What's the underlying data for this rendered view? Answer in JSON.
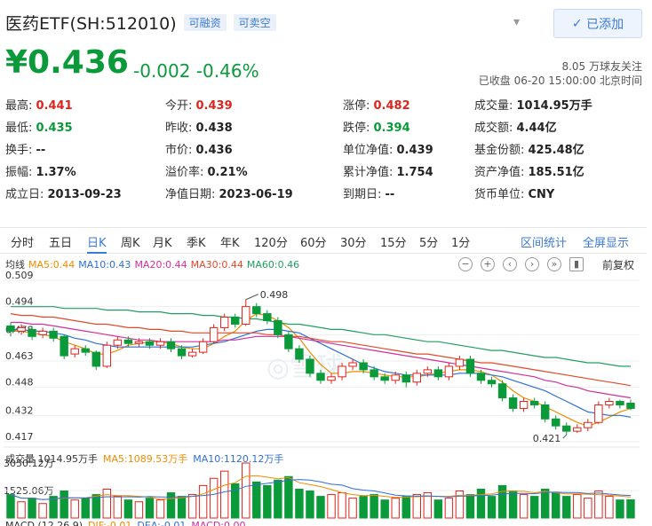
{
  "header": {
    "name": "医药ETF(SH:512010)",
    "tags": [
      "可融资",
      "可卖空"
    ],
    "add_button": "已添加",
    "price": "¥0.436",
    "change": "-0.002",
    "change_pct": "-0.46%",
    "followers": "8.05 万球友关注",
    "status": "已收盘 06-20 15:00:00 北京时间"
  },
  "quote": [
    [
      {
        "label": "最高:",
        "value": "0.441",
        "tone": "up"
      },
      {
        "label": "今开:",
        "value": "0.439",
        "tone": "up"
      },
      {
        "label": "涨停:",
        "value": "0.482",
        "tone": "up"
      },
      {
        "label": "成交量:",
        "value": "1014.95万手",
        "tone": ""
      }
    ],
    [
      {
        "label": "最低:",
        "value": "0.435",
        "tone": "down"
      },
      {
        "label": "昨收:",
        "value": "0.438",
        "tone": ""
      },
      {
        "label": "跌停:",
        "value": "0.394",
        "tone": "down"
      },
      {
        "label": "成交额:",
        "value": "4.44亿",
        "tone": ""
      }
    ],
    [
      {
        "label": "换手:",
        "value": "--",
        "tone": ""
      },
      {
        "label": "市价:",
        "value": "0.436",
        "tone": ""
      },
      {
        "label": "单位净值:",
        "value": "0.439",
        "tone": ""
      },
      {
        "label": "基金份额:",
        "value": "425.48亿",
        "tone": ""
      }
    ],
    [
      {
        "label": "振幅:",
        "value": "1.37%",
        "tone": ""
      },
      {
        "label": "溢价率:",
        "value": "0.21%",
        "tone": ""
      },
      {
        "label": "累计净值:",
        "value": "1.754",
        "tone": ""
      },
      {
        "label": "资产净值:",
        "value": "185.51亿",
        "tone": ""
      }
    ],
    [
      {
        "label": "成立日:",
        "value": "2013-09-23",
        "tone": ""
      },
      {
        "label": "净值日期:",
        "value": "2023-06-19",
        "tone": ""
      },
      {
        "label": "到期日:",
        "value": "--",
        "tone": ""
      },
      {
        "label": "货币单位:",
        "value": "CNY",
        "tone": ""
      }
    ]
  ],
  "periods": [
    "分时",
    "五日",
    "日K",
    "周K",
    "月K",
    "季K",
    "年K",
    "120分",
    "60分",
    "30分",
    "15分",
    "5分",
    "1分"
  ],
  "active_period": "日K",
  "links": {
    "interval_stats": "区间统计",
    "fullscreen": "全屏显示"
  },
  "ma_legend": [
    {
      "text": "均线",
      "color": "#333333"
    },
    {
      "text": "MA5:0.44",
      "color": "#f08c00"
    },
    {
      "text": "MA10:0.43",
      "color": "#2f6fd6"
    },
    {
      "text": "MA20:0.44",
      "color": "#d0309a"
    },
    {
      "text": "MA30:0.44",
      "color": "#e04a2a"
    },
    {
      "text": "MA60:0.46",
      "color": "#20a060"
    }
  ],
  "adjust_label": "前复权",
  "volume_legend": [
    {
      "text": "成交量 1014.95万手",
      "color": "#333333"
    },
    {
      "text": "MA5:1089.53万手",
      "color": "#f08c00"
    },
    {
      "text": "MA10:1120.12万手",
      "color": "#2f6fd6"
    }
  ],
  "macd_legend": [
    {
      "text": "MACD (12,26,9)",
      "color": "#333333"
    },
    {
      "text": "DIF:-0.01",
      "color": "#f08c00"
    },
    {
      "text": "DEA:-0.01",
      "color": "#2f6fd6"
    },
    {
      "text": "MACD:0.00",
      "color": "#d0309a"
    }
  ],
  "chart_data": {
    "type": "candlestick",
    "y_ticks": [
      "0.509",
      "0.494",
      "0.478",
      "0.463",
      "0.448",
      "0.432",
      "0.417"
    ],
    "ylim": [
      0.417,
      0.509
    ],
    "annotations": [
      {
        "text": "0.498",
        "value": 0.498,
        "index": 22
      },
      {
        "text": "0.421",
        "value": 0.421,
        "index": 52
      }
    ],
    "volume_ticks": [
      "3050.12万",
      "1525.06万"
    ],
    "volume_max": 3050.12,
    "candles": [
      [
        0.483,
        0.48,
        0.485,
        0.477
      ],
      [
        0.48,
        0.482,
        0.484,
        0.478
      ],
      [
        0.481,
        0.477,
        0.483,
        0.475
      ],
      [
        0.478,
        0.48,
        0.482,
        0.476
      ],
      [
        0.48,
        0.476,
        0.482,
        0.474
      ],
      [
        0.477,
        0.466,
        0.478,
        0.464
      ],
      [
        0.467,
        0.47,
        0.472,
        0.465
      ],
      [
        0.47,
        0.468,
        0.472,
        0.466
      ],
      [
        0.468,
        0.46,
        0.469,
        0.458
      ],
      [
        0.46,
        0.472,
        0.474,
        0.459
      ],
      [
        0.472,
        0.475,
        0.477,
        0.47
      ],
      [
        0.475,
        0.473,
        0.477,
        0.471
      ],
      [
        0.473,
        0.474,
        0.476,
        0.471
      ],
      [
        0.474,
        0.472,
        0.476,
        0.47
      ],
      [
        0.472,
        0.474,
        0.476,
        0.47
      ],
      [
        0.474,
        0.47,
        0.476,
        0.468
      ],
      [
        0.47,
        0.466,
        0.472,
        0.464
      ],
      [
        0.466,
        0.468,
        0.47,
        0.465
      ],
      [
        0.468,
        0.474,
        0.476,
        0.467
      ],
      [
        0.474,
        0.482,
        0.484,
        0.473
      ],
      [
        0.482,
        0.488,
        0.49,
        0.48
      ],
      [
        0.488,
        0.484,
        0.49,
        0.482
      ],
      [
        0.484,
        0.494,
        0.498,
        0.483
      ],
      [
        0.494,
        0.49,
        0.496,
        0.488
      ],
      [
        0.49,
        0.486,
        0.492,
        0.484
      ],
      [
        0.486,
        0.478,
        0.488,
        0.476
      ],
      [
        0.478,
        0.47,
        0.48,
        0.468
      ],
      [
        0.47,
        0.464,
        0.472,
        0.462
      ],
      [
        0.464,
        0.456,
        0.466,
        0.454
      ],
      [
        0.456,
        0.452,
        0.458,
        0.45
      ],
      [
        0.452,
        0.454,
        0.456,
        0.45
      ],
      [
        0.454,
        0.46,
        0.462,
        0.452
      ],
      [
        0.46,
        0.462,
        0.464,
        0.458
      ],
      [
        0.462,
        0.458,
        0.464,
        0.456
      ],
      [
        0.458,
        0.454,
        0.46,
        0.452
      ],
      [
        0.454,
        0.452,
        0.456,
        0.45
      ],
      [
        0.452,
        0.455,
        0.457,
        0.45
      ],
      [
        0.455,
        0.451,
        0.457,
        0.448
      ],
      [
        0.451,
        0.456,
        0.458,
        0.449
      ],
      [
        0.456,
        0.458,
        0.46,
        0.454
      ],
      [
        0.458,
        0.454,
        0.46,
        0.452
      ],
      [
        0.454,
        0.46,
        0.462,
        0.452
      ],
      [
        0.46,
        0.464,
        0.466,
        0.458
      ],
      [
        0.464,
        0.456,
        0.466,
        0.454
      ],
      [
        0.456,
        0.452,
        0.458,
        0.45
      ],
      [
        0.452,
        0.45,
        0.454,
        0.448
      ],
      [
        0.45,
        0.442,
        0.452,
        0.44
      ],
      [
        0.442,
        0.436,
        0.444,
        0.434
      ],
      [
        0.436,
        0.44,
        0.442,
        0.434
      ],
      [
        0.44,
        0.438,
        0.442,
        0.436
      ],
      [
        0.438,
        0.43,
        0.44,
        0.428
      ],
      [
        0.43,
        0.426,
        0.432,
        0.424
      ],
      [
        0.426,
        0.423,
        0.428,
        0.421
      ],
      [
        0.423,
        0.425,
        0.427,
        0.422
      ],
      [
        0.425,
        0.428,
        0.43,
        0.423
      ],
      [
        0.428,
        0.438,
        0.44,
        0.427
      ],
      [
        0.438,
        0.44,
        0.442,
        0.436
      ],
      [
        0.44,
        0.438,
        0.441,
        0.436
      ],
      [
        0.439,
        0.436,
        0.441,
        0.435
      ]
    ],
    "volumes": [
      1300,
      900,
      1100,
      800,
      1200,
      1500,
      1000,
      1100,
      1300,
      1600,
      1200,
      1000,
      900,
      1100,
      1000,
      1400,
      1200,
      1300,
      1800,
      2200,
      2600,
      1900,
      3050,
      2000,
      1800,
      2100,
      2300,
      1600,
      1500,
      1200,
      1300,
      1400,
      1100,
      1200,
      1300,
      1000,
      1100,
      1200,
      1300,
      1400,
      1000,
      1100,
      1500,
      1300,
      1600,
      1200,
      1800,
      1500,
      1300,
      1200,
      1600,
      1400,
      1200,
      1300,
      1100,
      1500,
      1200,
      1000,
      1015
    ],
    "ma_lines": [
      {
        "name": "MA5",
        "color": "#f08c00",
        "values": [
          0.48,
          0.48,
          0.479,
          0.478,
          0.477,
          0.474,
          0.472,
          0.47,
          0.467,
          0.467,
          0.469,
          0.472,
          0.473,
          0.474,
          0.474,
          0.473,
          0.471,
          0.47,
          0.47,
          0.473,
          0.477,
          0.48,
          0.486,
          0.49,
          0.489,
          0.486,
          0.482,
          0.476,
          0.468,
          0.461,
          0.456,
          0.456,
          0.457,
          0.457,
          0.456,
          0.455,
          0.454,
          0.454,
          0.454,
          0.455,
          0.456,
          0.457,
          0.458,
          0.458,
          0.457,
          0.455,
          0.451,
          0.446,
          0.442,
          0.44,
          0.437,
          0.434,
          0.431,
          0.428,
          0.426,
          0.428,
          0.431,
          0.434,
          0.436
        ]
      },
      {
        "name": "MA10",
        "color": "#2f6fd6",
        "values": [
          0.481,
          0.481,
          0.48,
          0.48,
          0.479,
          0.478,
          0.476,
          0.475,
          0.473,
          0.472,
          0.471,
          0.471,
          0.471,
          0.471,
          0.471,
          0.471,
          0.471,
          0.471,
          0.472,
          0.473,
          0.474,
          0.476,
          0.478,
          0.48,
          0.481,
          0.481,
          0.48,
          0.479,
          0.476,
          0.473,
          0.47,
          0.467,
          0.464,
          0.461,
          0.459,
          0.457,
          0.456,
          0.455,
          0.455,
          0.455,
          0.455,
          0.455,
          0.456,
          0.456,
          0.456,
          0.455,
          0.454,
          0.452,
          0.45,
          0.448,
          0.446,
          0.443,
          0.44,
          0.437,
          0.434,
          0.433,
          0.432,
          0.432,
          0.431
        ]
      },
      {
        "name": "MA20",
        "color": "#d0309a",
        "values": [
          0.485,
          0.485,
          0.484,
          0.484,
          0.483,
          0.482,
          0.481,
          0.48,
          0.479,
          0.478,
          0.477,
          0.476,
          0.475,
          0.475,
          0.474,
          0.474,
          0.474,
          0.474,
          0.474,
          0.474,
          0.475,
          0.475,
          0.476,
          0.477,
          0.477,
          0.477,
          0.477,
          0.476,
          0.475,
          0.474,
          0.473,
          0.472,
          0.471,
          0.47,
          0.469,
          0.468,
          0.467,
          0.466,
          0.465,
          0.464,
          0.463,
          0.462,
          0.461,
          0.46,
          0.459,
          0.458,
          0.457,
          0.456,
          0.455,
          0.454,
          0.452,
          0.451,
          0.449,
          0.448,
          0.446,
          0.445,
          0.444,
          0.443,
          0.442
        ]
      },
      {
        "name": "MA30",
        "color": "#e04a2a",
        "values": [
          0.49,
          0.489,
          0.489,
          0.488,
          0.488,
          0.487,
          0.486,
          0.485,
          0.484,
          0.484,
          0.483,
          0.482,
          0.482,
          0.481,
          0.481,
          0.48,
          0.48,
          0.479,
          0.479,
          0.479,
          0.479,
          0.479,
          0.479,
          0.479,
          0.478,
          0.478,
          0.477,
          0.477,
          0.476,
          0.475,
          0.474,
          0.474,
          0.473,
          0.472,
          0.471,
          0.47,
          0.469,
          0.468,
          0.467,
          0.467,
          0.466,
          0.465,
          0.464,
          0.463,
          0.462,
          0.462,
          0.461,
          0.46,
          0.459,
          0.458,
          0.457,
          0.456,
          0.455,
          0.454,
          0.453,
          0.452,
          0.451,
          0.45,
          0.449
        ]
      },
      {
        "name": "MA60",
        "color": "#20a060",
        "values": [
          0.494,
          0.494,
          0.494,
          0.494,
          0.494,
          0.493,
          0.493,
          0.493,
          0.493,
          0.492,
          0.492,
          0.492,
          0.491,
          0.491,
          0.491,
          0.49,
          0.49,
          0.49,
          0.489,
          0.489,
          0.488,
          0.488,
          0.487,
          0.487,
          0.486,
          0.485,
          0.484,
          0.484,
          0.483,
          0.482,
          0.481,
          0.481,
          0.48,
          0.479,
          0.478,
          0.478,
          0.477,
          0.476,
          0.475,
          0.474,
          0.474,
          0.473,
          0.472,
          0.471,
          0.47,
          0.469,
          0.469,
          0.468,
          0.467,
          0.466,
          0.465,
          0.465,
          0.464,
          0.463,
          0.462,
          0.462,
          0.461,
          0.46,
          0.46
        ]
      }
    ],
    "colors": {
      "up": "#e0241d",
      "down": "#0a9a3a"
    }
  }
}
